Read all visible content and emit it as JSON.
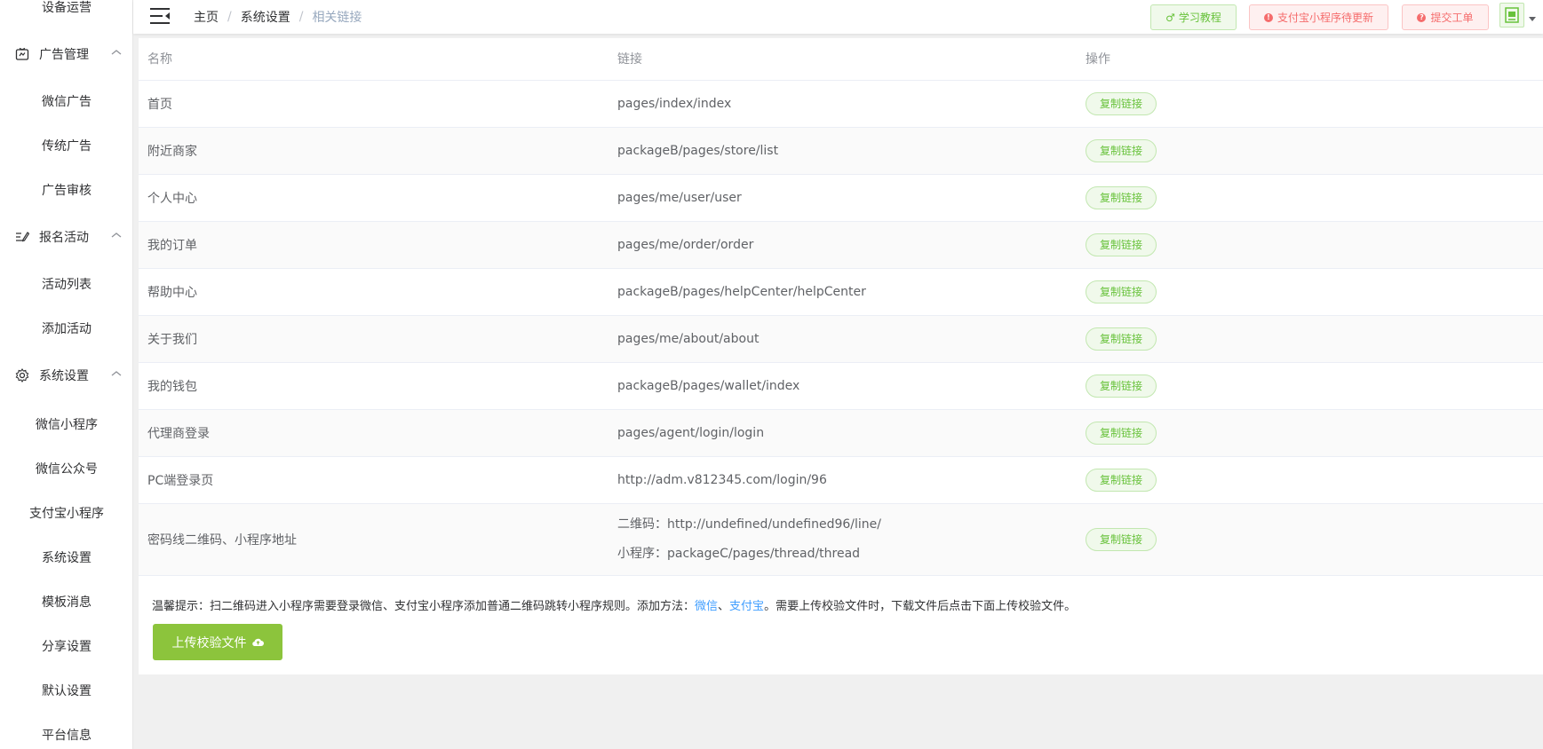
{
  "sidebar": {
    "items": [
      {
        "label": "设备运营"
      },
      {
        "label": "广告管理"
      },
      {
        "label": "微信广告"
      },
      {
        "label": "传统广告"
      },
      {
        "label": "广告审核"
      },
      {
        "label": "报名活动"
      },
      {
        "label": "活动列表"
      },
      {
        "label": "添加活动"
      },
      {
        "label": "系统设置"
      },
      {
        "label": "微信小程序"
      },
      {
        "label": "微信公众号"
      },
      {
        "label": "支付宝小程序"
      },
      {
        "label": "系统设置"
      },
      {
        "label": "模板消息"
      },
      {
        "label": "分享设置"
      },
      {
        "label": "默认设置"
      },
      {
        "label": "平台信息"
      }
    ]
  },
  "header": {
    "breadcrumb": [
      "主页",
      "系统设置",
      "相关链接"
    ],
    "learn_label": "学习教程",
    "alipay_label": "支付宝小程序待更新",
    "ticket_label": "提交工单"
  },
  "table": {
    "columns": [
      "名称",
      "链接",
      "操作"
    ],
    "copy_label": "复制链接",
    "rows": [
      {
        "name": "首页",
        "links": [
          "pages/index/index"
        ]
      },
      {
        "name": "附近商家",
        "links": [
          "packageB/pages/store/list"
        ]
      },
      {
        "name": "个人中心",
        "links": [
          "pages/me/user/user"
        ]
      },
      {
        "name": "我的订单",
        "links": [
          "pages/me/order/order"
        ]
      },
      {
        "name": "帮助中心",
        "links": [
          "packageB/pages/helpCenter/helpCenter"
        ]
      },
      {
        "name": "关于我们",
        "links": [
          "pages/me/about/about"
        ]
      },
      {
        "name": "我的钱包",
        "links": [
          "packageB/pages/wallet/index"
        ]
      },
      {
        "name": "代理商登录",
        "links": [
          "pages/agent/login/login"
        ]
      },
      {
        "name": "PC端登录页",
        "links": [
          "http://adm.v812345.com/login/96"
        ]
      },
      {
        "name": "密码线二维码、小程序地址",
        "links": [
          "二维码：http://undefined/undefined96/line/",
          "小程序：packageC/pages/thread/thread"
        ]
      }
    ]
  },
  "tip": {
    "prefix": "温馨提示：扫二维码进入小程序需要登录微信、支付宝小程序添加普通二维码跳转小程序规则。添加方法：",
    "link_wechat": "微信",
    "sep": "、",
    "link_alipay": "支付宝",
    "suffix": "。需要上传校验文件时，下载文件后点击下面上传校验文件。"
  },
  "upload_label": "上传校验文件"
}
